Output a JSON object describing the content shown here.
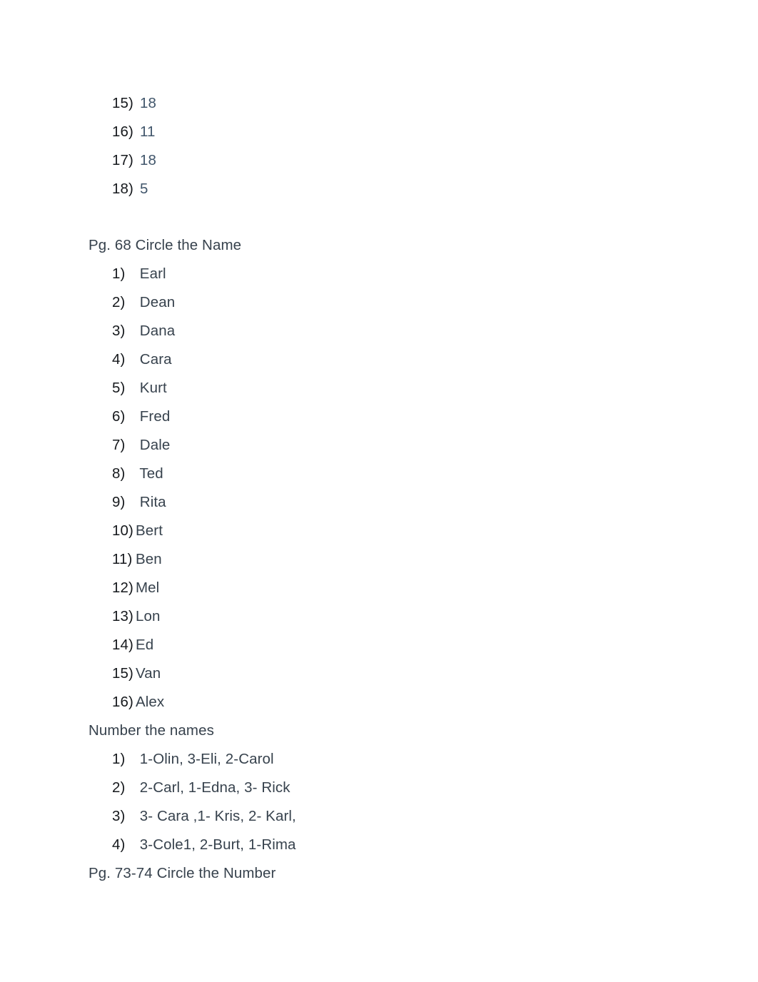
{
  "document": {
    "background_color": "#ffffff",
    "text_color": "#37424d",
    "marker_color": "#16191d",
    "answer_value_color": "#41566b"
  },
  "sections": [
    {
      "id": "answers-continued",
      "type": "list",
      "items": [
        {
          "marker": "15)",
          "text": "18"
        },
        {
          "marker": "16)",
          "text": "11"
        },
        {
          "marker": "17)",
          "text": "18"
        },
        {
          "marker": "18)",
          "text": "5"
        }
      ]
    },
    {
      "id": "pg68",
      "type": "heading",
      "heading": "Pg. 68 Circle the Name",
      "items": [
        {
          "marker": "1)",
          "text": " Earl"
        },
        {
          "marker": "2)",
          "text": " Dean"
        },
        {
          "marker": "3)",
          "text": " Dana"
        },
        {
          "marker": "4)",
          "text": " Cara"
        },
        {
          "marker": "5)",
          "text": " Kurt"
        },
        {
          "marker": "6)",
          "text": " Fred"
        },
        {
          "marker": "7)",
          "text": " Dale"
        },
        {
          "marker": "8)",
          "text": " Ted"
        },
        {
          "marker": "9)",
          "text": " Rita"
        },
        {
          "marker": "10)",
          "text": "Bert"
        },
        {
          "marker": "11)",
          "text": "Ben"
        },
        {
          "marker": "12)",
          "text": "Mel"
        },
        {
          "marker": "13)",
          "text": "Lon"
        },
        {
          "marker": "14)",
          "text": "Ed"
        },
        {
          "marker": "15)",
          "text": "Van"
        },
        {
          "marker": "16)",
          "text": "Alex"
        }
      ]
    },
    {
      "id": "number-the-names",
      "type": "heading",
      "heading": "Number the names",
      "items": [
        {
          "marker": "1)",
          "text": " 1-Olin, 3-Eli, 2-Carol"
        },
        {
          "marker": "2)",
          "text": " 2-Carl, 1-Edna, 3- Rick"
        },
        {
          "marker": "3)",
          "text": " 3- Cara ,1- Kris, 2- Karl,"
        },
        {
          "marker": "4)",
          "text": " 3-Cole1, 2-Burt, 1-Rima"
        }
      ]
    },
    {
      "id": "pg73-74",
      "type": "heading",
      "heading": "Pg. 73-74 Circle the Number",
      "items": []
    }
  ]
}
